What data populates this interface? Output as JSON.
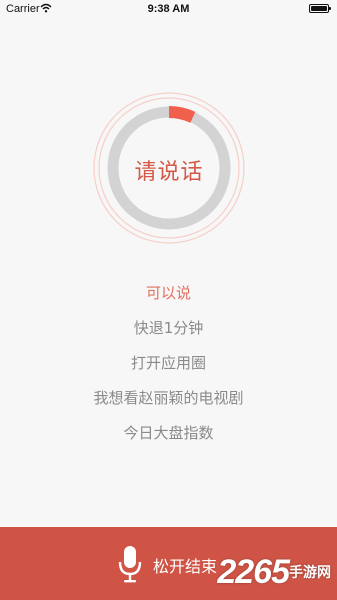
{
  "status_bar": {
    "carrier": "Carrier",
    "time": "9:38 AM"
  },
  "mic_ring": {
    "label": "请说话",
    "level_fraction": 0.07,
    "colors": {
      "track": "#d3d3d3",
      "progress": "#f0604c",
      "halo": "#f6cfc8"
    }
  },
  "suggestions": [
    "可以说",
    "快退1分钟",
    "打开应用圈",
    "我想看赵丽颖的电视剧",
    "今日大盘指数"
  ],
  "bottom_bar": {
    "label": "松开结束",
    "icon": "microphone-icon",
    "background": "#cf5446"
  },
  "watermark": {
    "main": "2265",
    "sub": "手游网"
  }
}
